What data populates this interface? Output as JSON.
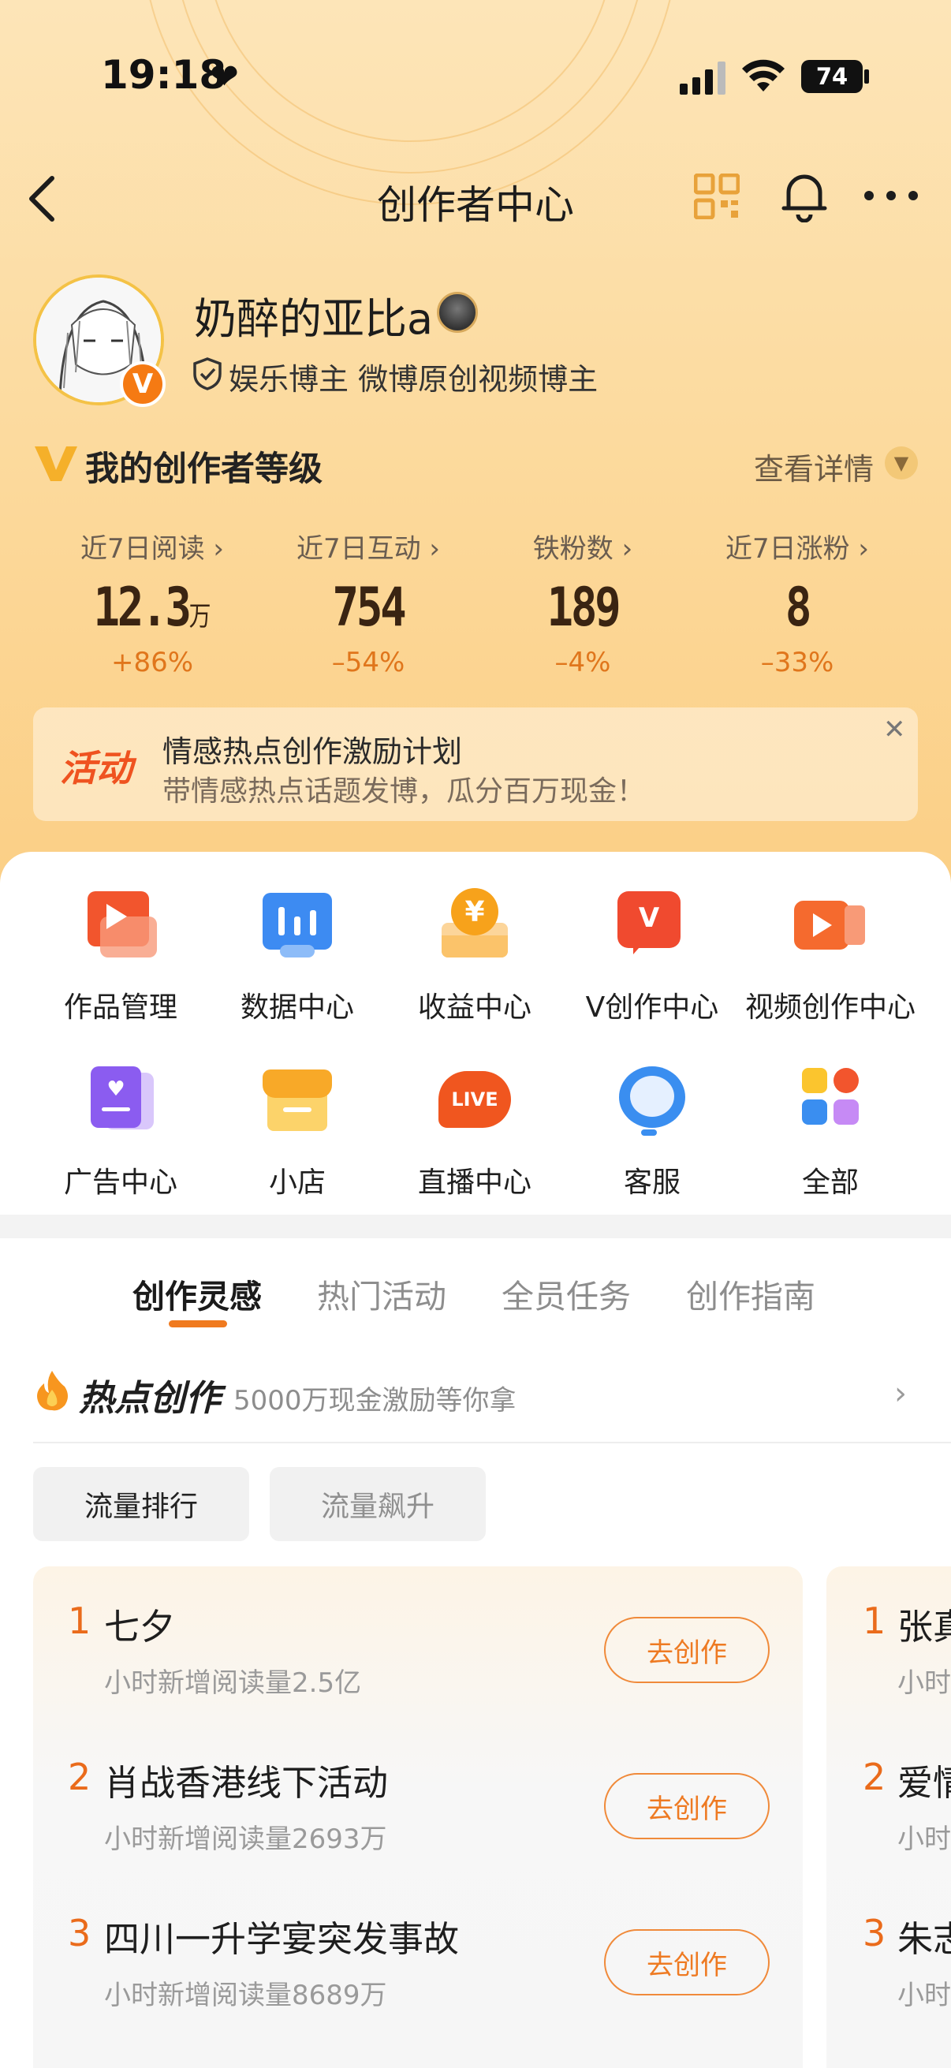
{
  "status_bar": {
    "time": "19:18",
    "battery": "74"
  },
  "nav": {
    "title": "创作者中心"
  },
  "profile": {
    "name": "奶醉的亚比a",
    "verified_badge": "V",
    "tags": "娱乐博主 微博原创视频博主"
  },
  "level": {
    "title": "我的创作者等级",
    "detail_link": "查看详情"
  },
  "stats": [
    {
      "label": "近7日阅读",
      "value": "12.3",
      "unit": "万",
      "delta": "+86%"
    },
    {
      "label": "近7日互动",
      "value": "754",
      "unit": "",
      "delta": "–54%"
    },
    {
      "label": "铁粉数",
      "value": "189",
      "unit": "",
      "delta": "–4%"
    },
    {
      "label": "近7日涨粉",
      "value": "8",
      "unit": "",
      "delta": "–33%"
    }
  ],
  "banner": {
    "tag": "活动",
    "title": "情感热点创作激励计划",
    "subtitle": "带情感热点话题发博，瓜分百万现金！"
  },
  "tools": [
    {
      "label": "作品管理",
      "icon": "works-icon"
    },
    {
      "label": "数据中心",
      "icon": "data-icon"
    },
    {
      "label": "收益中心",
      "icon": "income-icon"
    },
    {
      "label": "V创作中心",
      "icon": "v-create-icon"
    },
    {
      "label": "视频创作中心",
      "icon": "video-icon"
    },
    {
      "label": "广告中心",
      "icon": "ad-icon"
    },
    {
      "label": "小店",
      "icon": "shop-icon"
    },
    {
      "label": "直播中心",
      "icon": "live-icon"
    },
    {
      "label": "客服",
      "icon": "service-icon"
    },
    {
      "label": "全部",
      "icon": "all-icon"
    }
  ],
  "tabs": [
    "创作灵感",
    "热门活动",
    "全员任务",
    "创作指南"
  ],
  "hot": {
    "title": "热点创作",
    "subtitle": "5000万现金激励等你拿"
  },
  "chips": [
    "流量排行",
    "流量飙升"
  ],
  "ranking": [
    {
      "rank": "1",
      "title": "七夕",
      "sub": "小时新增阅读量2.5亿",
      "button": "去创作"
    },
    {
      "rank": "2",
      "title": "肖战香港线下活动",
      "sub": "小时新增阅读量2693万",
      "button": "去创作"
    },
    {
      "rank": "3",
      "title": "四川一升学宴突发事故",
      "sub": "小时新增阅读量8689万",
      "button": "去创作"
    }
  ],
  "ranking_peek": [
    {
      "rank": "1",
      "title": "张真",
      "sub": "小时"
    },
    {
      "rank": "2",
      "title": "爱情",
      "sub": "小时"
    },
    {
      "rank": "3",
      "title": "朱志",
      "sub": "小时"
    }
  ],
  "colors": {
    "accent": "#f07a1f",
    "header_bg": "#fcd99b",
    "level_v": "#f5b02a"
  }
}
